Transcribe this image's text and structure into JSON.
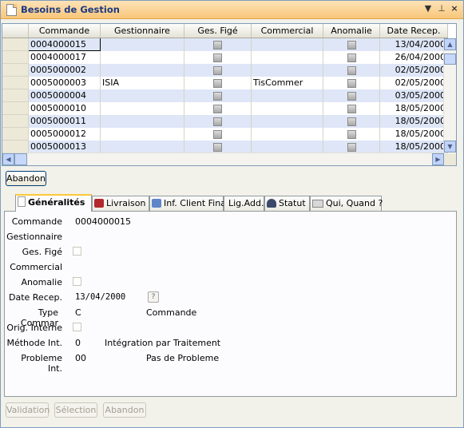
{
  "window": {
    "title": "Besoins de Gestion"
  },
  "grid": {
    "columns": [
      "Commande",
      "Gestionnaire",
      "Ges. Figé",
      "Commercial",
      "Anomalie",
      "Date Recep."
    ],
    "rows": [
      {
        "commande": "0004000015",
        "gestionnaire": "",
        "commercial": "",
        "date": "13/04/2000"
      },
      {
        "commande": "0004000017",
        "gestionnaire": "",
        "commercial": "",
        "date": "26/04/2000"
      },
      {
        "commande": "0005000002",
        "gestionnaire": "",
        "commercial": "",
        "date": "02/05/2000"
      },
      {
        "commande": "0005000003",
        "gestionnaire": "ISIA",
        "commercial": "TisCommer",
        "date": "02/05/2000"
      },
      {
        "commande": "0005000004",
        "gestionnaire": "",
        "commercial": "",
        "date": "03/05/2000"
      },
      {
        "commande": "0005000010",
        "gestionnaire": "",
        "commercial": "",
        "date": "18/05/2000"
      },
      {
        "commande": "0005000011",
        "gestionnaire": "",
        "commercial": "",
        "date": "18/05/2000"
      },
      {
        "commande": "0005000012",
        "gestionnaire": "",
        "commercial": "",
        "date": "18/05/2000"
      },
      {
        "commande": "0005000013",
        "gestionnaire": "",
        "commercial": "",
        "date": "18/05/2000"
      }
    ]
  },
  "abandon_top": "Abandon",
  "tabs": [
    "Généralités",
    "Livraison",
    "Inf. Client Final",
    "Lig.Add.",
    "Statut",
    "Qui, Quand ?"
  ],
  "form": {
    "commande_label": "Commande",
    "commande_value": "0004000015",
    "gestionnaire_label": "Gestionnaire",
    "ges_fige_label": "Ges. Figé",
    "commercial_label": "Commercial",
    "anomalie_label": "Anomalie",
    "date_label": "Date Recep.",
    "date_value": "13/04/2000",
    "help_glyph": "?",
    "type_label": "Type Commar",
    "type_code": "C",
    "type_text": "Commande",
    "orig_label": "Orig. Interne",
    "methode_label": "Méthode Int.",
    "methode_code": "0",
    "methode_text": "Intégration par Traitement",
    "probleme_label": "Probleme Int.",
    "probleme_code": "00",
    "probleme_text": "Pas de Probleme"
  },
  "bottom_buttons": {
    "validation": "Validation",
    "selection": "Sélection",
    "abandon": "Abandon"
  },
  "colors": {
    "title_bar": "#f8c679",
    "row_alt": "#dee6f7",
    "active_tab": "#ffc83c"
  }
}
